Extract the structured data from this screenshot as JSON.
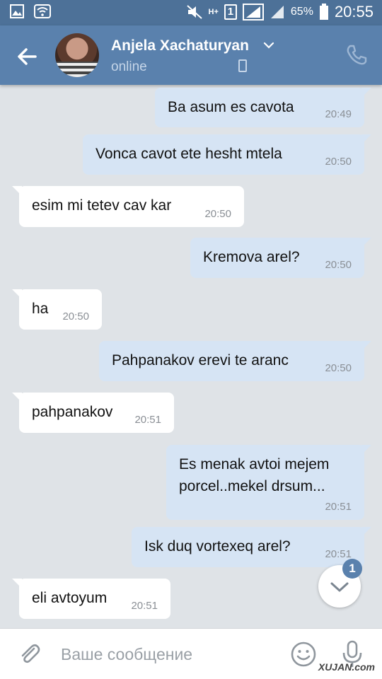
{
  "status_bar": {
    "network": "H+",
    "sim": "1",
    "battery": "65%",
    "time": "20:55"
  },
  "header": {
    "contact_name": "Anjela Xachaturyan",
    "status": "online"
  },
  "messages": [
    {
      "direction": "out",
      "text": "Ba asum es cavota",
      "time": "20:49"
    },
    {
      "direction": "out",
      "text": "Vonca cavot ete hesht mtela",
      "time": "20:50"
    },
    {
      "direction": "in",
      "text": "esim mi tetev cav kar",
      "time": "20:50"
    },
    {
      "direction": "out",
      "text": "Kremova arel?",
      "time": "20:50"
    },
    {
      "direction": "in",
      "text": "ha",
      "time": "20:50"
    },
    {
      "direction": "out",
      "text": "Pahpanakov erevi te aranc",
      "time": "20:50"
    },
    {
      "direction": "in",
      "text": "pahpanakov",
      "time": "20:51"
    },
    {
      "direction": "out",
      "text": "Es menak avtoi mejem porcel..mekel drsum...",
      "time": "20:51"
    },
    {
      "direction": "out",
      "text": "Isk duq vortexeq arel?",
      "time": "20:51"
    },
    {
      "direction": "in",
      "text": "eli avtoyum",
      "time": "20:51"
    }
  ],
  "unread_badge": "1",
  "composer": {
    "placeholder": "Ваше сообщение"
  },
  "watermark": "XUJAN.com",
  "colors": {
    "header": "#5a81ad",
    "status_bar": "#4d7198",
    "background": "#dfe3e7",
    "outgoing_bubble": "#d6e4f4",
    "incoming_bubble": "#ffffff"
  }
}
